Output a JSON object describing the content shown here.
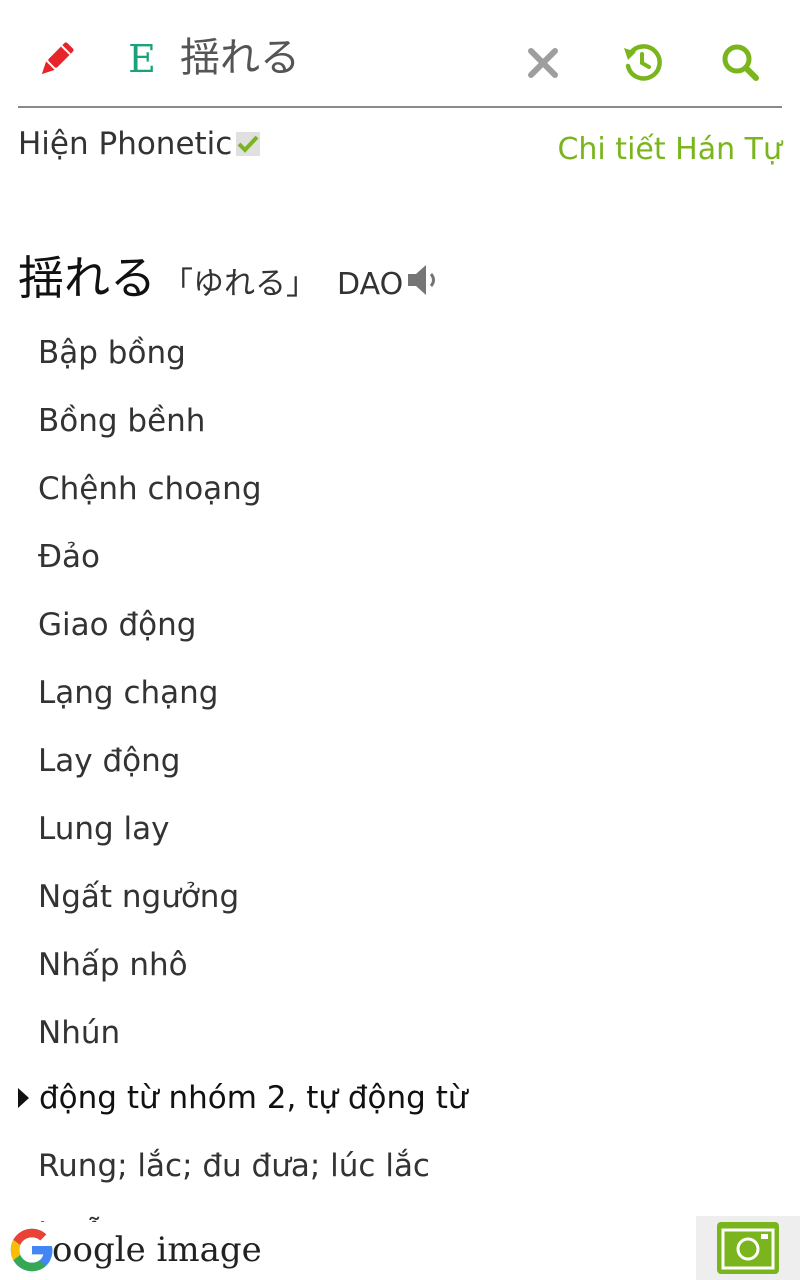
{
  "header": {
    "lang_label": "E",
    "search_value": "揺れる"
  },
  "options": {
    "phonetic_label": "Hiện Phonetic",
    "phonetic_checked": true,
    "kanji_detail_link": "Chi tiết Hán Tự"
  },
  "entry": {
    "word": "揺れる",
    "reading": "「ゆれる」",
    "han_viet": "DAO",
    "meanings": [
      "Bập bồng",
      "Bồng bềnh",
      "Chệnh choạng",
      "Đảo",
      "Giao động",
      "Lạng chạng",
      "Lay động",
      "Lung lay",
      "Ngất ngưởng",
      "Nhấp nhô",
      "Nhún"
    ],
    "part_of_speech": "động từ nhóm 2, tự động từ",
    "sub_meaning": "Rung; lắc; đu đưa; lúc lắc",
    "cut_off_text": "Lư ỗ"
  },
  "footer": {
    "google_image_label": "oogle image"
  },
  "colors": {
    "accent_green": "#7ab51d",
    "pencil_red": "#e8242b",
    "lang_teal": "#1aa37a"
  },
  "icons": [
    "pencil-icon",
    "clear-icon",
    "history-icon",
    "search-icon",
    "speaker-icon",
    "checkmark-icon",
    "google-g-icon",
    "camera-icon",
    "triangle-right-icon"
  ]
}
